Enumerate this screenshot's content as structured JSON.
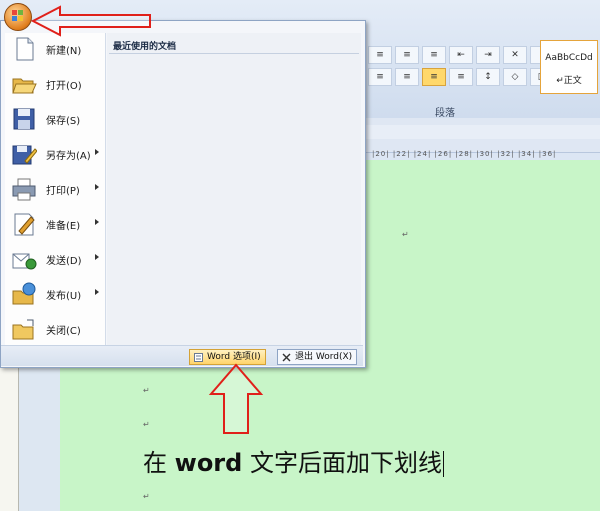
{
  "ribbon": {
    "paragraph_group_label": "段落",
    "styles_preview": "AaBbCcDd",
    "styles_name": "↵正文",
    "ruler_ticks": "|20|  |22|  |24|  |26|  |28|  |30|  |32|  |34|  |36|"
  },
  "menu": {
    "items": [
      {
        "label": "新建(N)",
        "icon": "new-document-icon",
        "has_submenu": false
      },
      {
        "label": "打开(O)",
        "icon": "open-folder-icon",
        "has_submenu": false
      },
      {
        "label": "保存(S)",
        "icon": "save-disk-icon",
        "has_submenu": false
      },
      {
        "label": "另存为(A)",
        "icon": "save-as-icon",
        "has_submenu": true
      },
      {
        "label": "打印(P)",
        "icon": "printer-icon",
        "has_submenu": true
      },
      {
        "label": "准备(E)",
        "icon": "prepare-icon",
        "has_submenu": true
      },
      {
        "label": "发送(D)",
        "icon": "send-icon",
        "has_submenu": true
      },
      {
        "label": "发布(U)",
        "icon": "publish-icon",
        "has_submenu": true
      },
      {
        "label": "关闭(C)",
        "icon": "close-folder-icon",
        "has_submenu": false
      }
    ],
    "recent_title": "最近使用的文档",
    "word_options_label": "Word 选项(I)",
    "exit_word_label": "退出 Word(X)"
  },
  "document": {
    "text_prefix": "在 ",
    "text_bold": "word",
    "text_suffix": " 文字后面加下划线",
    "paragraph_mark": "↵"
  },
  "colors": {
    "page_background": "#c8f5c8",
    "annotation_arrow": "#e0201a",
    "office_button": "#e07d1c"
  }
}
